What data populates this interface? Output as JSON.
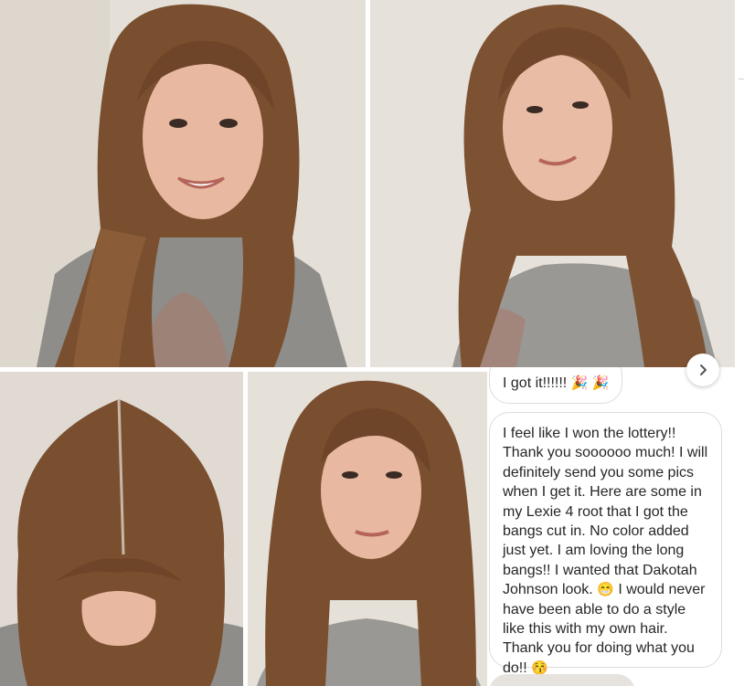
{
  "chat": {
    "message_short": "I got it!!!!!!",
    "message_short_emoji": "🎉 🎉",
    "message_long_1": "I feel like I won the lottery!! Thank you soooooo much! I will definitely send you some pics when I get it. Here are some in my Lexie 4 root that I got the bangs cut in. No color added just yet. I am loving the long bangs!! I wanted that Dakotah Johnson look.",
    "emoji_grin": "😁",
    "message_long_2": "I would never have been able to do a style like this with my own hair. Thank you for doing what you do!!",
    "emoji_kiss": "😚"
  },
  "icons": {
    "next": "chevron-right-icon"
  },
  "colors": {
    "hair": "#7a4f2f",
    "wall": "#e3ddd4",
    "shirt": "#9a9894"
  }
}
